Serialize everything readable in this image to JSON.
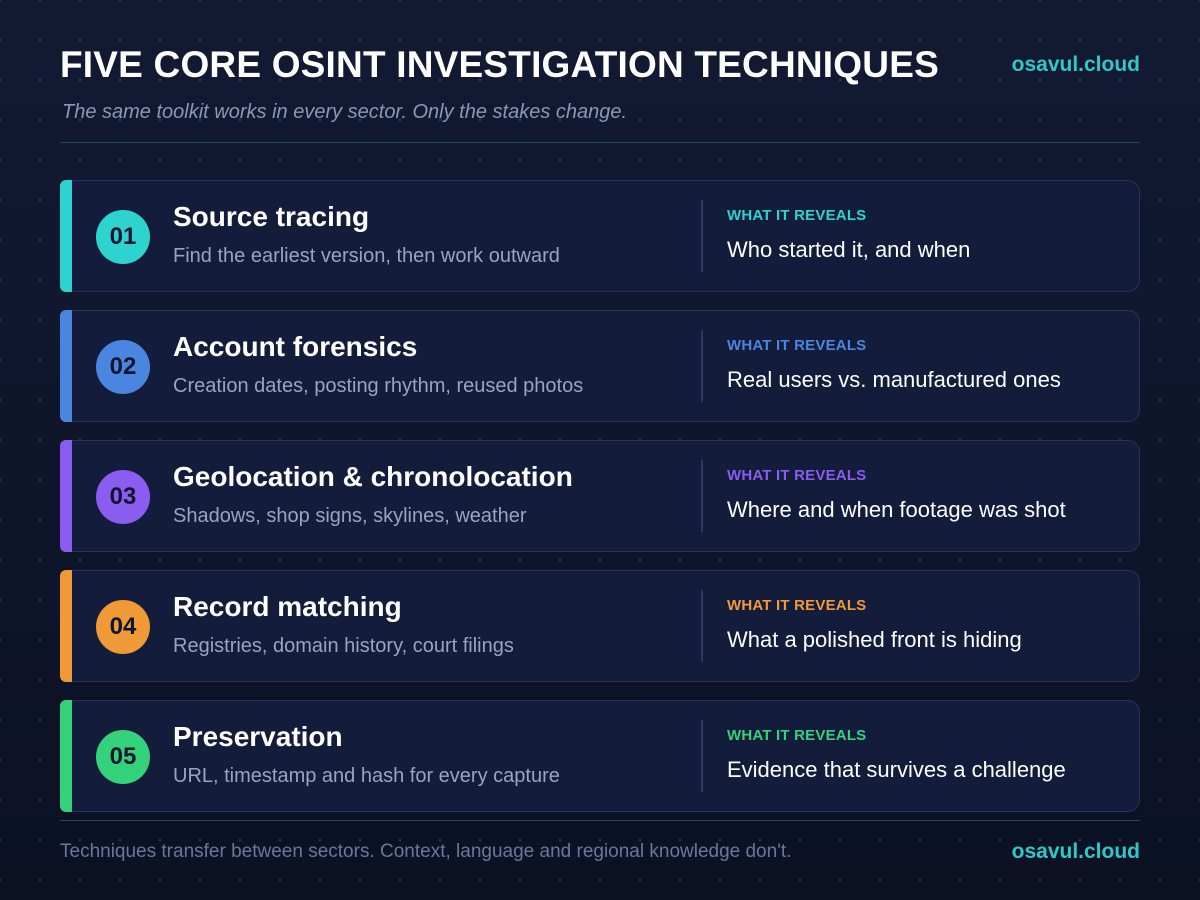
{
  "header": {
    "title": "FIVE CORE OSINT INVESTIGATION TECHNIQUES",
    "subtitle": "The same toolkit works in every sector. Only the stakes change.",
    "brand": "osavul.cloud"
  },
  "techniques": [
    {
      "number": "01",
      "name": "Source tracing",
      "description": "Find the earliest version, then work outward",
      "reveal_label": "WHAT IT REVEALS",
      "reveal_text": "Who started it, and when",
      "color": "#2dd4cf"
    },
    {
      "number": "02",
      "name": "Account forensics",
      "description": "Creation dates, posting rhythm, reused photos",
      "reveal_label": "WHAT IT REVEALS",
      "reveal_text": "Real users vs. manufactured ones",
      "color": "#4a86e0"
    },
    {
      "number": "03",
      "name": "Geolocation & chronolocation",
      "description": "Shadows, shop signs, skylines, weather",
      "reveal_label": "WHAT IT REVEALS",
      "reveal_text": "Where and when footage was shot",
      "color": "#8b5cf0"
    },
    {
      "number": "04",
      "name": "Record matching",
      "description": "Registries, domain history, court filings",
      "reveal_label": "WHAT IT REVEALS",
      "reveal_text": "What a polished front is hiding",
      "color": "#ef9a36"
    },
    {
      "number": "05",
      "name": "Preservation",
      "description": "URL, timestamp and hash for every capture",
      "reveal_label": "WHAT IT REVEALS",
      "reveal_text": "Evidence that survives a challenge",
      "color": "#34d27a"
    }
  ],
  "footer": {
    "note": "Techniques transfer between sectors. Context, language and regional knowledge don't.",
    "brand": "osavul.cloud"
  }
}
